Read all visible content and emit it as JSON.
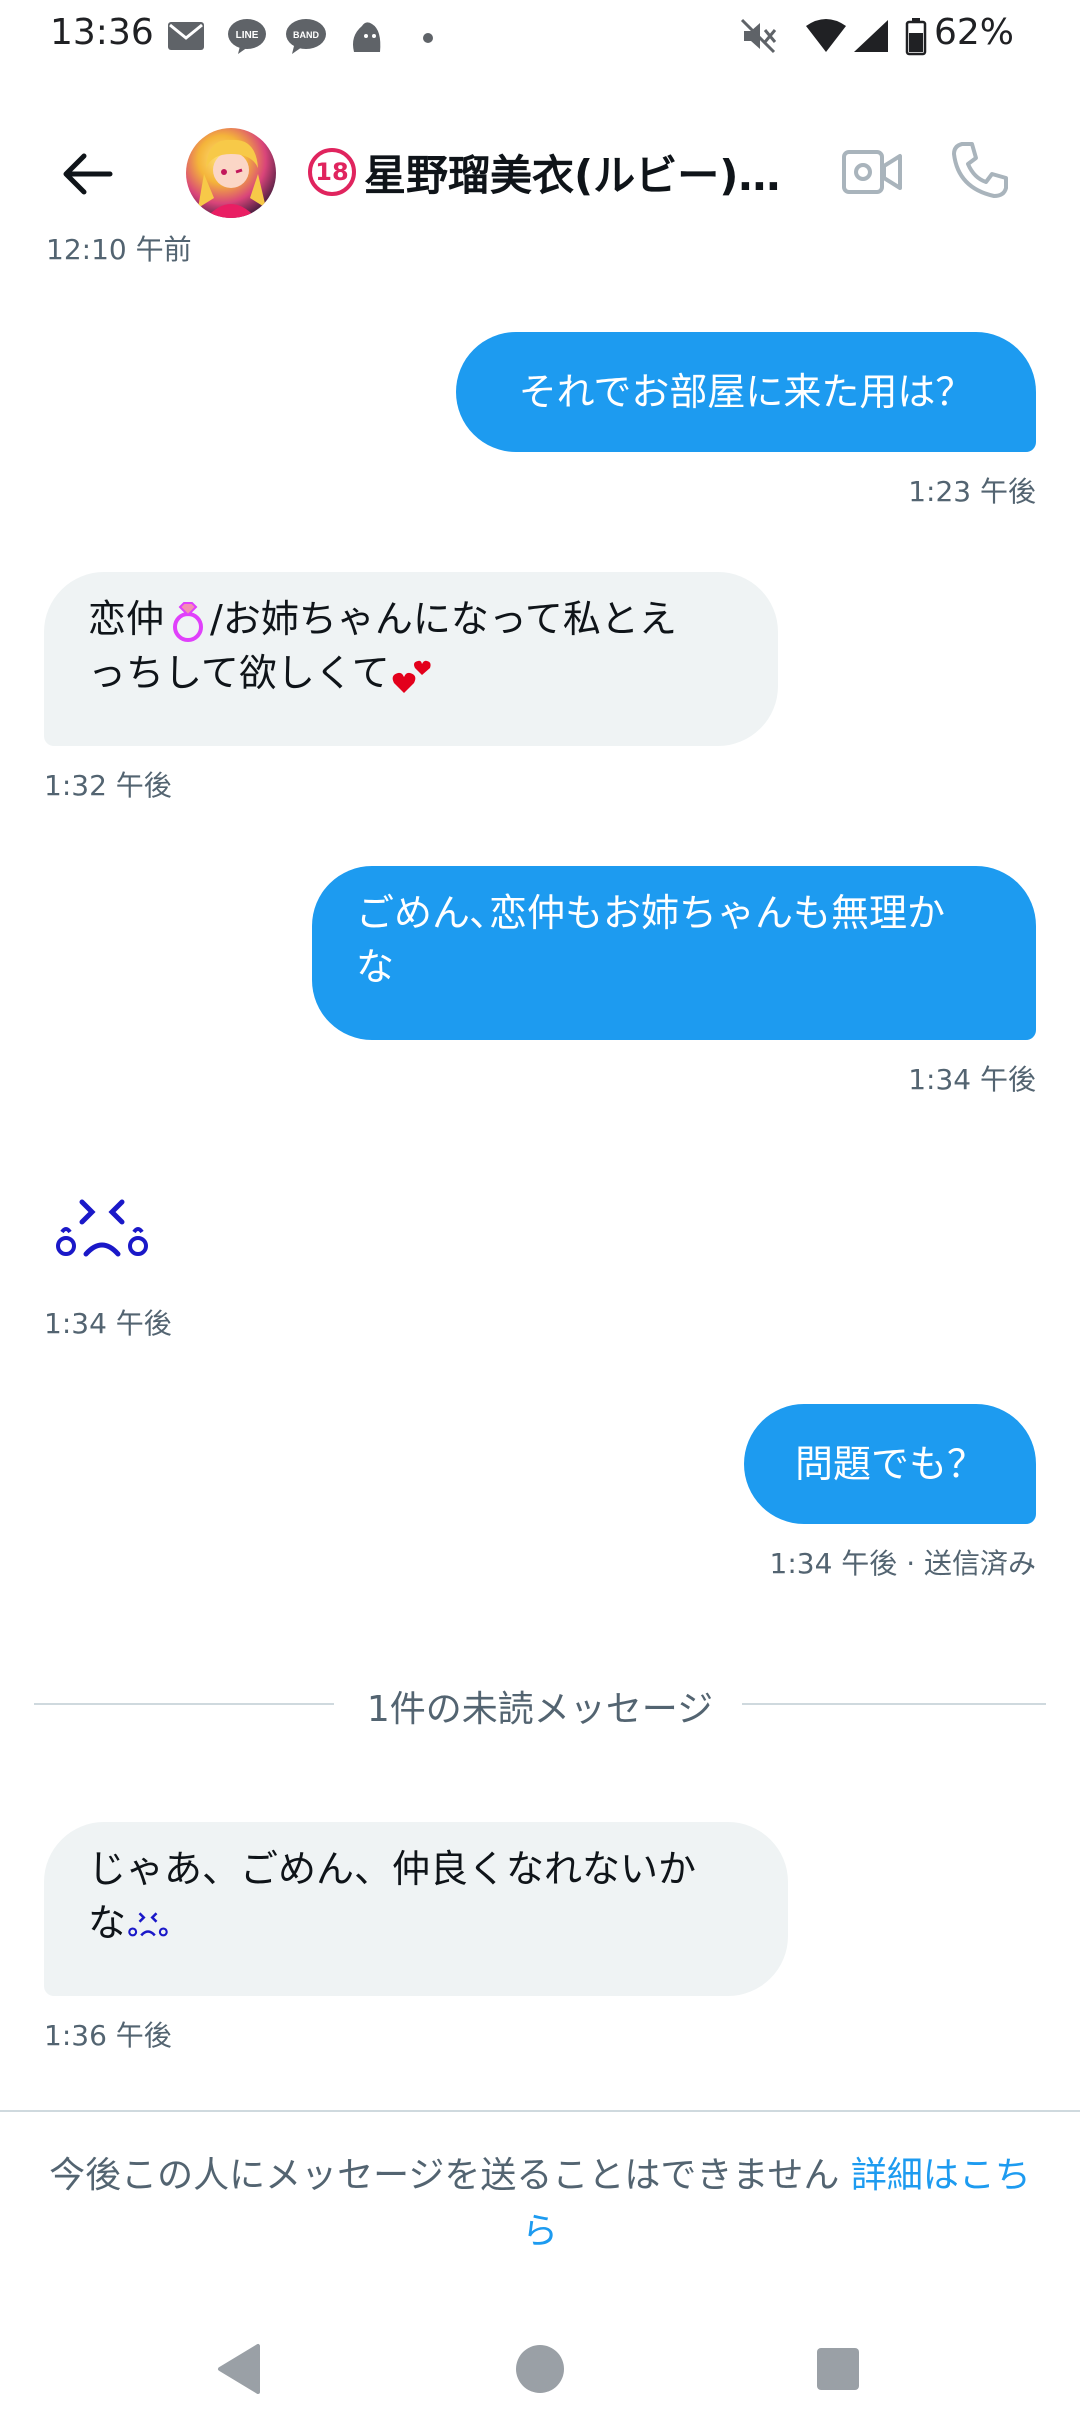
{
  "status_bar": {
    "time": "13:36",
    "battery": "62%",
    "notification_icons": [
      "mail-icon",
      "line-icon",
      "band-icon",
      "bird-app-icon",
      "dot-icon"
    ],
    "system_icons": [
      "mute-icon",
      "wifi-icon",
      "signal-icon",
      "battery-icon"
    ]
  },
  "header": {
    "age_badge": "18",
    "contact_name": "星野瑠美衣(ルビー)…"
  },
  "conversation": {
    "old_timestamp": "12:10 午前",
    "messages": [
      {
        "from": "me",
        "text": "それでお部屋に来た用は？",
        "time": "1:23 午後"
      },
      {
        "from": "them",
        "line1_a": "恋仲",
        "line1_b": "/お姉ちゃんになって私とえ",
        "line2": "っちして欲しくて",
        "time": "1:32 午後"
      },
      {
        "from": "me",
        "line1": "ごめん､恋仲もお姉ちゃんも無理か",
        "line2": "な",
        "time": "1:34 午後"
      },
      {
        "from": "them",
        "sticker": "crying-face-icon",
        "time": "1:34 午後"
      },
      {
        "from": "me",
        "text": "問題でも？",
        "time": "1:34 午後 · 送信済み"
      }
    ],
    "unread_divider": "1件の未読メッセージ",
    "unread_messages": [
      {
        "from": "them",
        "line1": "じゃあ、ごめん、仲良くなれないか",
        "line2": "な",
        "time": "1:36 午後"
      }
    ]
  },
  "notice": {
    "text": "今後この人にメッセージを送ることはできません ",
    "link": "詳細はこちら"
  },
  "colors": {
    "accent": "#1d9bf0",
    "bubble_other": "#eff3f4",
    "muted_text": "#536471",
    "age_badge": "#e0245e"
  }
}
